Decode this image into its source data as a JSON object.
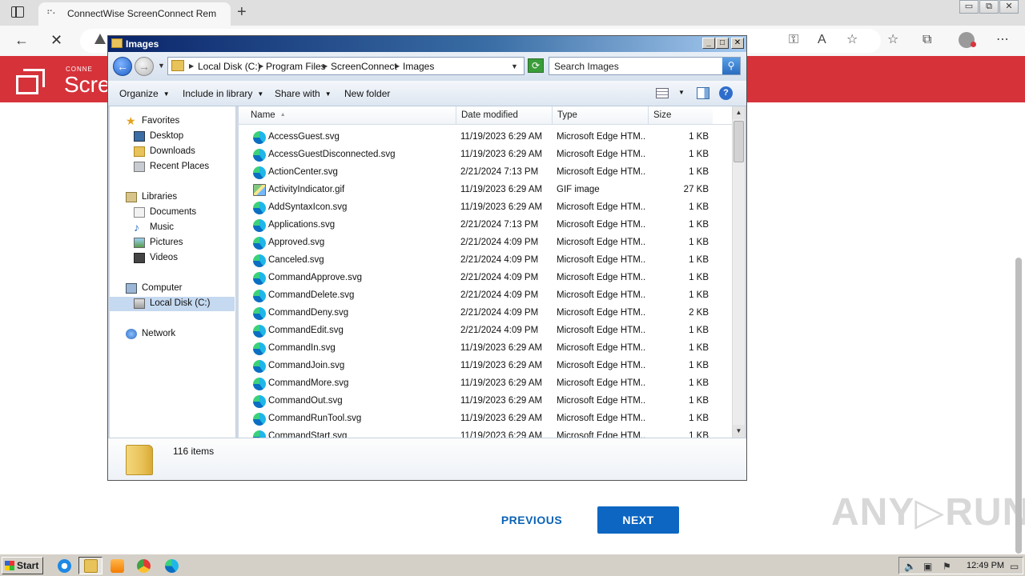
{
  "browser": {
    "tab_title": "ConnectWise ScreenConnect Rem",
    "new_tab": "+",
    "window_buttons": [
      "▭",
      "⧉",
      "✕"
    ]
  },
  "page": {
    "logo_small": "CONNE",
    "logo_text": "Scree",
    "previous_label": "PREVIOUS",
    "next_label": "NEXT",
    "watermark": "ANY▷RUN"
  },
  "explorer": {
    "title": "Images",
    "breadcrumb": [
      "Local Disk (C:)",
      "Program Files",
      "ScreenConnect",
      "Images"
    ],
    "search_placeholder": "Search Images",
    "commands": [
      "Organize",
      "Include in library",
      "Share with",
      "New folder"
    ],
    "nav": {
      "favorites": "Favorites",
      "desktop": "Desktop",
      "downloads": "Downloads",
      "recent": "Recent Places",
      "libraries": "Libraries",
      "documents": "Documents",
      "music": "Music",
      "pictures": "Pictures",
      "videos": "Videos",
      "computer": "Computer",
      "local_disk": "Local Disk (C:)",
      "network": "Network"
    },
    "columns": [
      "Name",
      "Date modified",
      "Type",
      "Size"
    ],
    "files": [
      {
        "name": "AccessGuest.svg",
        "date": "11/19/2023 6:29 AM",
        "type": "Microsoft Edge HTM...",
        "size": "1 KB"
      },
      {
        "name": "AccessGuestDisconnected.svg",
        "date": "11/19/2023 6:29 AM",
        "type": "Microsoft Edge HTM...",
        "size": "1 KB"
      },
      {
        "name": "ActionCenter.svg",
        "date": "2/21/2024 7:13 PM",
        "type": "Microsoft Edge HTM...",
        "size": "1 KB"
      },
      {
        "name": "ActivityIndicator.gif",
        "date": "11/19/2023 6:29 AM",
        "type": "GIF image",
        "size": "27 KB"
      },
      {
        "name": "AddSyntaxIcon.svg",
        "date": "11/19/2023 6:29 AM",
        "type": "Microsoft Edge HTM...",
        "size": "1 KB"
      },
      {
        "name": "Applications.svg",
        "date": "2/21/2024 7:13 PM",
        "type": "Microsoft Edge HTM...",
        "size": "1 KB"
      },
      {
        "name": "Approved.svg",
        "date": "2/21/2024 4:09 PM",
        "type": "Microsoft Edge HTM...",
        "size": "1 KB"
      },
      {
        "name": "Canceled.svg",
        "date": "2/21/2024 4:09 PM",
        "type": "Microsoft Edge HTM...",
        "size": "1 KB"
      },
      {
        "name": "CommandApprove.svg",
        "date": "2/21/2024 4:09 PM",
        "type": "Microsoft Edge HTM...",
        "size": "1 KB"
      },
      {
        "name": "CommandDelete.svg",
        "date": "2/21/2024 4:09 PM",
        "type": "Microsoft Edge HTM...",
        "size": "1 KB"
      },
      {
        "name": "CommandDeny.svg",
        "date": "2/21/2024 4:09 PM",
        "type": "Microsoft Edge HTM...",
        "size": "2 KB"
      },
      {
        "name": "CommandEdit.svg",
        "date": "2/21/2024 4:09 PM",
        "type": "Microsoft Edge HTM...",
        "size": "1 KB"
      },
      {
        "name": "CommandIn.svg",
        "date": "11/19/2023 6:29 AM",
        "type": "Microsoft Edge HTM...",
        "size": "1 KB"
      },
      {
        "name": "CommandJoin.svg",
        "date": "11/19/2023 6:29 AM",
        "type": "Microsoft Edge HTM...",
        "size": "1 KB"
      },
      {
        "name": "CommandMore.svg",
        "date": "11/19/2023 6:29 AM",
        "type": "Microsoft Edge HTM...",
        "size": "1 KB"
      },
      {
        "name": "CommandOut.svg",
        "date": "11/19/2023 6:29 AM",
        "type": "Microsoft Edge HTM...",
        "size": "1 KB"
      },
      {
        "name": "CommandRunTool.svg",
        "date": "11/19/2023 6:29 AM",
        "type": "Microsoft Edge HTM...",
        "size": "1 KB"
      },
      {
        "name": "CommandStart.svg",
        "date": "11/19/2023 6:29 AM",
        "type": "Microsoft Edge HTM...",
        "size": "1 KB"
      }
    ],
    "status": "116 items"
  },
  "taskbar": {
    "start_label": "Start",
    "clock": "12:49 PM"
  },
  "colors": {
    "brand_red": "#d6323a",
    "accent_blue": "#0c66c2"
  }
}
